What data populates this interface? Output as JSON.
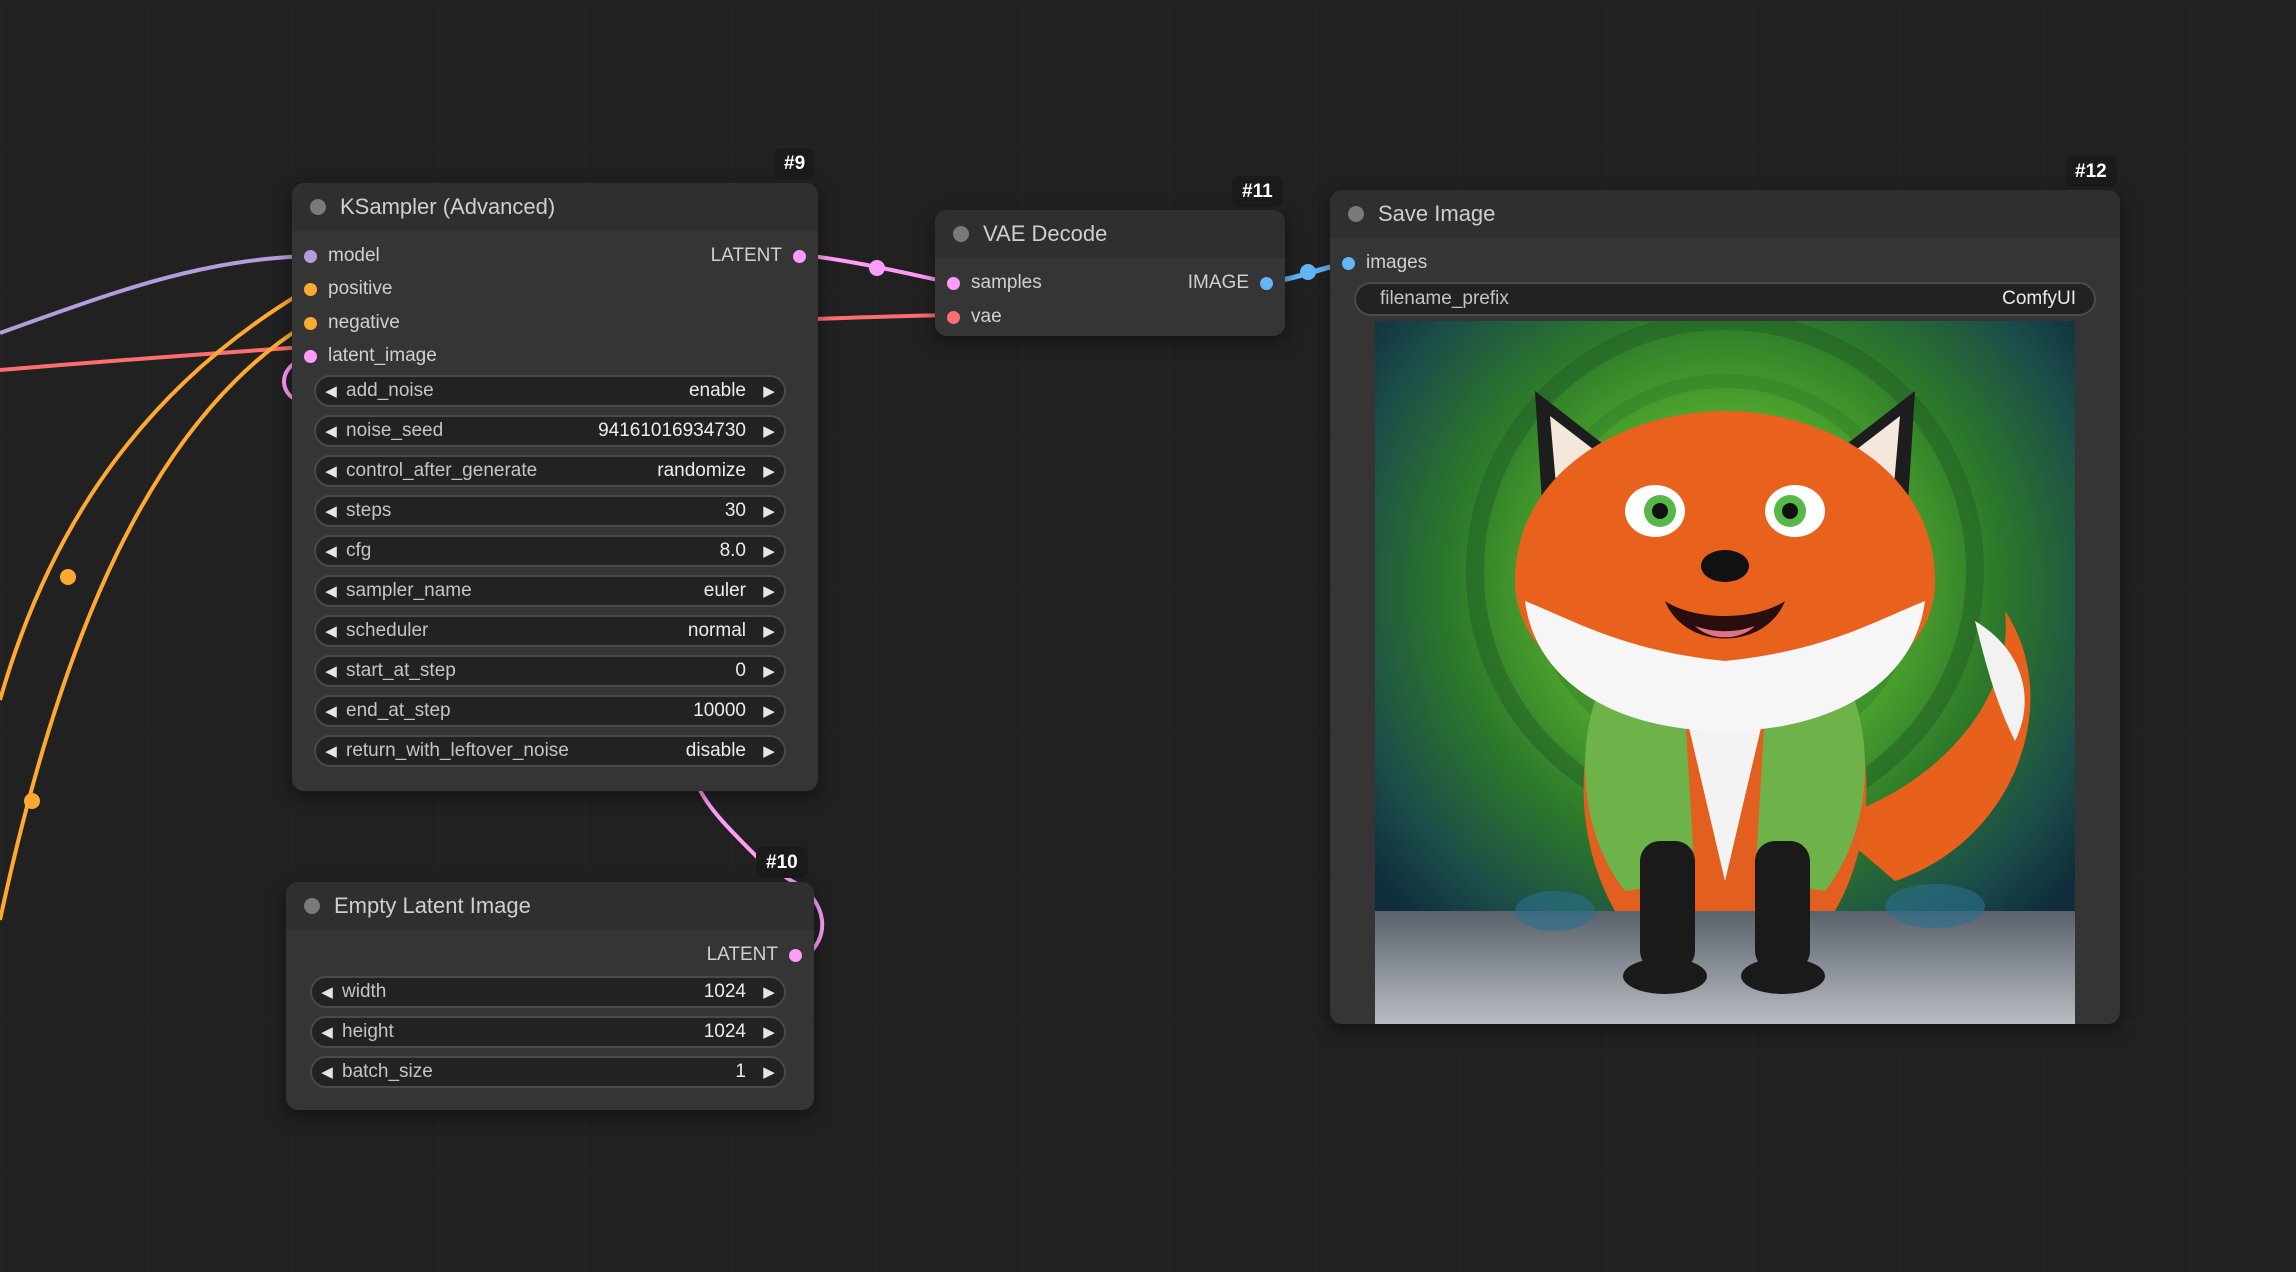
{
  "canvas": {
    "background": "#212121"
  },
  "slot_colors": {
    "model": "#b39ddb",
    "conditioning": "#ffa931",
    "latent": "#ff9cf9",
    "vae": "#ff6e6e",
    "image": "#64b5f6"
  },
  "nodes": {
    "ksampler": {
      "id": "#9",
      "title": "KSampler (Advanced)",
      "inputs": [
        "model",
        "positive",
        "negative",
        "latent_image"
      ],
      "output": "LATENT",
      "widgets": [
        {
          "label": "add_noise",
          "value": "enable"
        },
        {
          "label": "noise_seed",
          "value": "94161016934730"
        },
        {
          "label": "control_after_generate",
          "value": "randomize"
        },
        {
          "label": "steps",
          "value": "30"
        },
        {
          "label": "cfg",
          "value": "8.0"
        },
        {
          "label": "sampler_name",
          "value": "euler"
        },
        {
          "label": "scheduler",
          "value": "normal"
        },
        {
          "label": "start_at_step",
          "value": "0"
        },
        {
          "label": "end_at_step",
          "value": "10000"
        },
        {
          "label": "return_with_leftover_noise",
          "value": "disable"
        }
      ]
    },
    "vae_decode": {
      "id": "#11",
      "title": "VAE Decode",
      "inputs": [
        "samples",
        "vae"
      ],
      "output": "IMAGE"
    },
    "save_image": {
      "id": "#12",
      "title": "Save Image",
      "inputs": [
        "images"
      ],
      "filename_prefix": {
        "label": "filename_prefix",
        "value": "ComfyUI"
      }
    },
    "empty_latent": {
      "id": "#10",
      "title": "Empty Latent Image",
      "output": "LATENT",
      "widgets": [
        {
          "label": "width",
          "value": "1024"
        },
        {
          "label": "height",
          "value": "1024"
        },
        {
          "label": "batch_size",
          "value": "1"
        }
      ]
    }
  },
  "icons": {
    "decrement": "◀",
    "increment": "▶"
  }
}
